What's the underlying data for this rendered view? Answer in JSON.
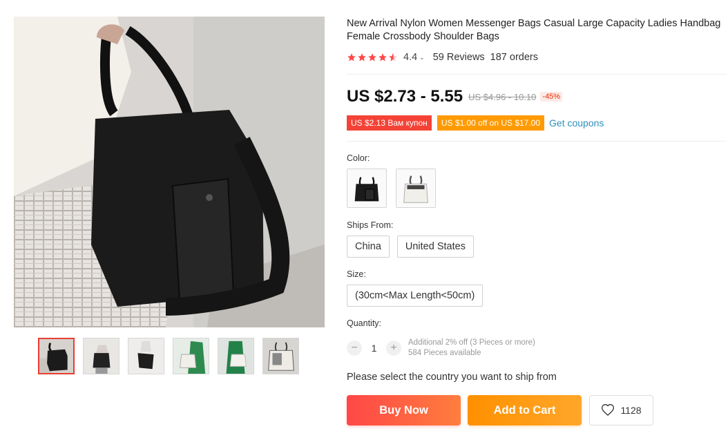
{
  "product": {
    "title": "New Arrival Nylon Women Messenger Bags Casual Large Capacity Ladies Handbag Female Crossbody Shoulder Bags",
    "rating": "4.4",
    "reviews": "59 Reviews",
    "orders": "187 orders",
    "stars_filled": 4.5
  },
  "price": {
    "current": "US $2.73 - 5.55",
    "original": "US $4.96 - 10.10",
    "discount": "-45%"
  },
  "coupons": {
    "red_label": "US $2.13 Вам купон",
    "orange_label": "US $1.00 off on US $17.00",
    "get_label": "Get coupons"
  },
  "options": {
    "color_label": "Color:",
    "ships_from_label": "Ships From:",
    "ships_from": [
      "China",
      "United States"
    ],
    "size_label": "Size:",
    "size": "(30cm<Max Length<50cm)",
    "quantity_label": "Quantity:"
  },
  "quantity": {
    "minus": "−",
    "value": "1",
    "plus": "+",
    "discount_note": "Additional 2% off (3 Pieces or more)",
    "available": "584 Pieces available"
  },
  "ship_note": "Please select the country you want to ship from",
  "buttons": {
    "buy": "Buy Now",
    "cart": "Add to Cart",
    "wishlist_count": "1128"
  },
  "colors": {
    "star": "#ff4747",
    "link": "#2d8fba",
    "coupon_red": "#f44336",
    "coupon_orange": "#ff9a00"
  },
  "icons": {
    "wishlist": "heart-icon",
    "rating_caret": "chevron-down-icon"
  }
}
